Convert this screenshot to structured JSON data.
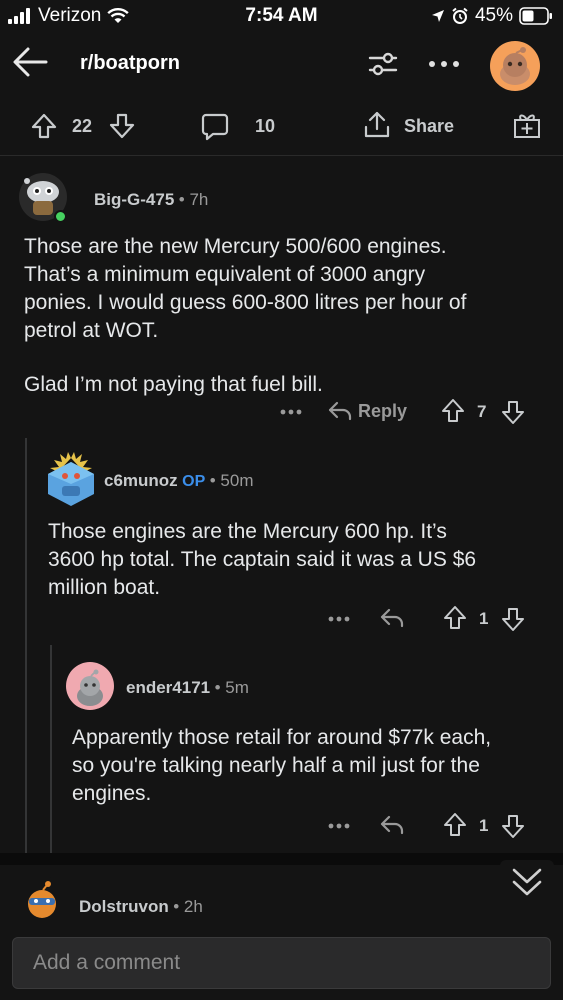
{
  "status_bar": {
    "carrier": "Verizon",
    "time": "7:54 AM",
    "battery": "45%"
  },
  "header": {
    "subreddit": "r/boatporn"
  },
  "action_bar": {
    "score": "22",
    "comments": "10",
    "share_label": "Share"
  },
  "comments": [
    {
      "username": "Big-G-475",
      "age": "7h",
      "body_lines": [
        "Those are the new Mercury 500/600 engines.",
        "That’s a minimum equivalent of 3000 angry",
        "ponies. I would guess 600-800 litres per hour of",
        "petrol at WOT."
      ],
      "body_paragraph2": "Glad I’m not paying that fuel bill.",
      "reply_label": "Reply",
      "score": "7"
    },
    {
      "username": "c6munoz",
      "op_badge": "OP",
      "age": "50m",
      "body_lines": [
        "Those engines are the Mercury 600 hp. It’s",
        "3600 hp total. The captain said it was a US $6",
        "million boat."
      ],
      "score": "1"
    },
    {
      "username": "ender4171",
      "age": "5m",
      "body_lines": [
        "Apparently those retail for around $77k each,",
        "so you're talking nearly half a mil just for the",
        "engines."
      ],
      "score": "1"
    },
    {
      "username": "Dolstruvon",
      "age": "2h"
    }
  ],
  "composer": {
    "placeholder": "Add a comment"
  },
  "colors": {
    "background": "#141414",
    "op_blue": "#3b8eea",
    "online_green": "#46d160"
  }
}
